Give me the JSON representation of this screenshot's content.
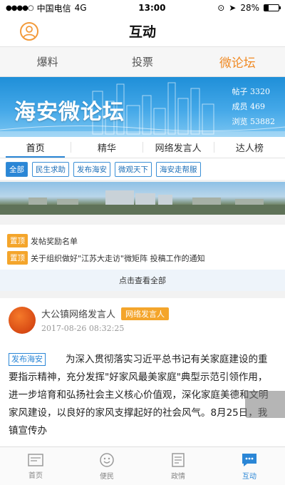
{
  "status_bar": {
    "carrier": "中国电信",
    "network": "4G",
    "time": "13:00",
    "battery": "28%"
  },
  "nav": {
    "title": "互动"
  },
  "top_tabs": [
    {
      "label": "爆料"
    },
    {
      "label": "投票"
    },
    {
      "label": "微论坛"
    }
  ],
  "banner": {
    "title": "海安微论坛",
    "stats": [
      {
        "label": "帖子",
        "value": "3320"
      },
      {
        "label": "成员",
        "value": "469"
      },
      {
        "label": "浏览",
        "value": "53882"
      }
    ]
  },
  "sub_tabs": [
    {
      "label": "首页"
    },
    {
      "label": "精华"
    },
    {
      "label": "网络发言人"
    },
    {
      "label": "达人榜"
    }
  ],
  "chips": [
    {
      "label": "全部"
    },
    {
      "label": "民生求助"
    },
    {
      "label": "发布海安"
    },
    {
      "label": "微观天下"
    },
    {
      "label": "海安走帮服"
    }
  ],
  "announcements": [
    {
      "badge": "置顶",
      "text": "发帖奖励名单"
    },
    {
      "badge": "置顶",
      "text": "关于组织做好\"江苏大走访\"微矩阵 投稿工作的通知"
    }
  ],
  "see_all": "点击查看全部",
  "post": {
    "author": "大公镇网络发言人",
    "role": "网络发言人",
    "time": "2017-08-26 08:32:25",
    "tag": "发布海安",
    "body": "为深入贯彻落实习近平总书记有关家庭建设的重要指示精神，充分发挥\"好家风最美家庭\"典型示范引领作用，进一步培育和弘扬社会主义核心价值观，深化家庭美德和文明家风建设，以良好的家风支撑起好的社会风气。8月25日，我镇宣传办"
  },
  "tab_bar": [
    {
      "label": "首页"
    },
    {
      "label": "便民"
    },
    {
      "label": "政情"
    },
    {
      "label": "互动"
    }
  ],
  "colors": {
    "accent": "#f08a24",
    "primary": "#2a86d6",
    "badge": "#f4a52b"
  }
}
